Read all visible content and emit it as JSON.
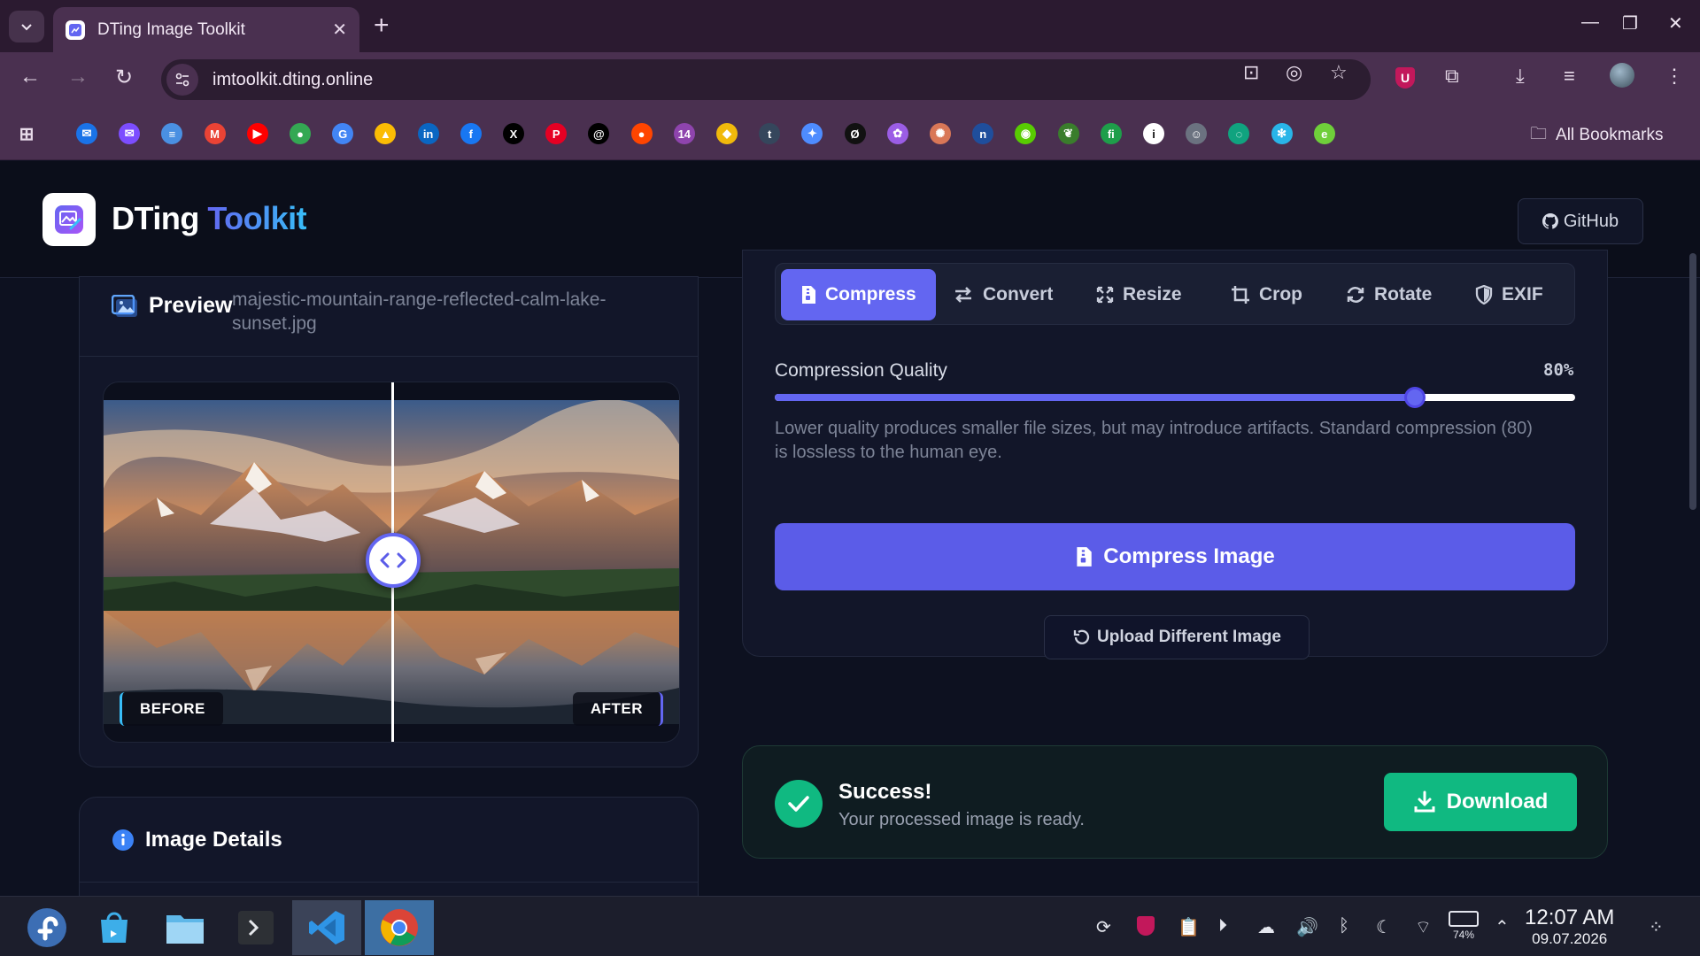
{
  "browser": {
    "tab_title": "DTing Image Toolkit",
    "tab_close": "✕",
    "new_tab": "+",
    "url": "imtoolkit.dting.online",
    "all_bookmarks": "All Bookmarks",
    "bookmarks": [
      {
        "icon": "outlook-icon",
        "color": "#1a73e8",
        "glyph": "✉"
      },
      {
        "icon": "mail-icon",
        "color": "#7c4dff",
        "glyph": "✉"
      },
      {
        "icon": "inbox-icon",
        "color": "#4a90e2",
        "glyph": "≡"
      },
      {
        "icon": "gmail-icon",
        "color": "#ea4335",
        "glyph": "M"
      },
      {
        "icon": "youtube-icon",
        "color": "#ff0000",
        "glyph": "▶"
      },
      {
        "icon": "maps-icon",
        "color": "#34a853",
        "glyph": "●"
      },
      {
        "icon": "translate-icon",
        "color": "#4285f4",
        "glyph": "G"
      },
      {
        "icon": "drive-icon",
        "color": "#fbbc04",
        "glyph": "▲"
      },
      {
        "icon": "linkedin-icon",
        "color": "#0a66c2",
        "glyph": "in"
      },
      {
        "icon": "facebook-icon",
        "color": "#1877f2",
        "glyph": "f"
      },
      {
        "icon": "x-icon",
        "color": "#000000",
        "glyph": "X"
      },
      {
        "icon": "pinterest-icon",
        "color": "#e60023",
        "glyph": "P"
      },
      {
        "icon": "threads-icon",
        "color": "#000000",
        "glyph": "@"
      },
      {
        "icon": "reddit-icon",
        "color": "#ff4500",
        "glyph": "●"
      },
      {
        "icon": "calendar-14-icon",
        "color": "#8e44ad",
        "glyph": "14"
      },
      {
        "icon": "binance-icon",
        "color": "#f0b90b",
        "glyph": "◆"
      },
      {
        "icon": "tumblr-icon",
        "color": "#35465c",
        "glyph": "t"
      },
      {
        "icon": "gemini-icon",
        "color": "#4e8cff",
        "glyph": "✦"
      },
      {
        "icon": "loop-icon",
        "color": "#111111",
        "glyph": "Ø"
      },
      {
        "icon": "flower-icon",
        "color": "#9b5de5",
        "glyph": "✿"
      },
      {
        "icon": "claude-icon",
        "color": "#d97757",
        "glyph": "✺"
      },
      {
        "icon": "notion-n-icon",
        "color": "#1f4e9c",
        "glyph": "n"
      },
      {
        "icon": "owl-icon",
        "color": "#58cc02",
        "glyph": "◉"
      },
      {
        "icon": "leaf-icon",
        "color": "#3a7d2c",
        "glyph": "❦"
      },
      {
        "icon": "fi-icon",
        "color": "#1e9e4a",
        "glyph": "fi"
      },
      {
        "icon": "info-icon",
        "color": "#ffffff",
        "glyph": "i"
      },
      {
        "icon": "avatar-site-icon",
        "color": "#6b7280",
        "glyph": "☺"
      },
      {
        "icon": "openai-icon",
        "color": "#10a37f",
        "glyph": "◌"
      },
      {
        "icon": "snowflake-icon",
        "color": "#29b5e8",
        "glyph": "✻"
      },
      {
        "icon": "e-icon",
        "color": "#6fcf3a",
        "glyph": "e"
      }
    ]
  },
  "header": {
    "brand_main": "DTing",
    "brand_accent": "Toolkit",
    "github_label": "GitHub"
  },
  "preview": {
    "title": "Preview",
    "filename": "majestic-mountain-range-reflected-calm-lake-sunset.jpg",
    "before_label": "BEFORE",
    "after_label": "AFTER",
    "divider_position": 0.5
  },
  "details": {
    "title": "Image Details"
  },
  "tools": {
    "tabs": [
      {
        "label": "Compress",
        "icon": "file-zip-icon",
        "active": true
      },
      {
        "label": "Convert",
        "icon": "arrows-swap-icon",
        "active": false
      },
      {
        "label": "Resize",
        "icon": "expand-icon",
        "active": false
      },
      {
        "label": "Crop",
        "icon": "crop-icon",
        "active": false
      },
      {
        "label": "Rotate",
        "icon": "rotate-icon",
        "active": false
      },
      {
        "label": "EXIF",
        "icon": "shield-icon",
        "active": false
      }
    ],
    "quality_label": "Compression Quality",
    "quality_value_text": "80%",
    "quality_value": 80,
    "hint": "Lower quality produces smaller file sizes, but may introduce artifacts. Standard compression (80) is lossless to the human eye.",
    "compress_button": "Compress Image",
    "upload_button": "Upload Different Image"
  },
  "result": {
    "title": "Success!",
    "subtitle": "Your processed image is ready.",
    "download_button": "Download"
  },
  "taskbar": {
    "time": "12:07 AM",
    "date": "09.07.2026",
    "battery": "74%"
  },
  "colors": {
    "accent": "#6366f1",
    "success": "#10b981",
    "background": "#0d1120"
  }
}
